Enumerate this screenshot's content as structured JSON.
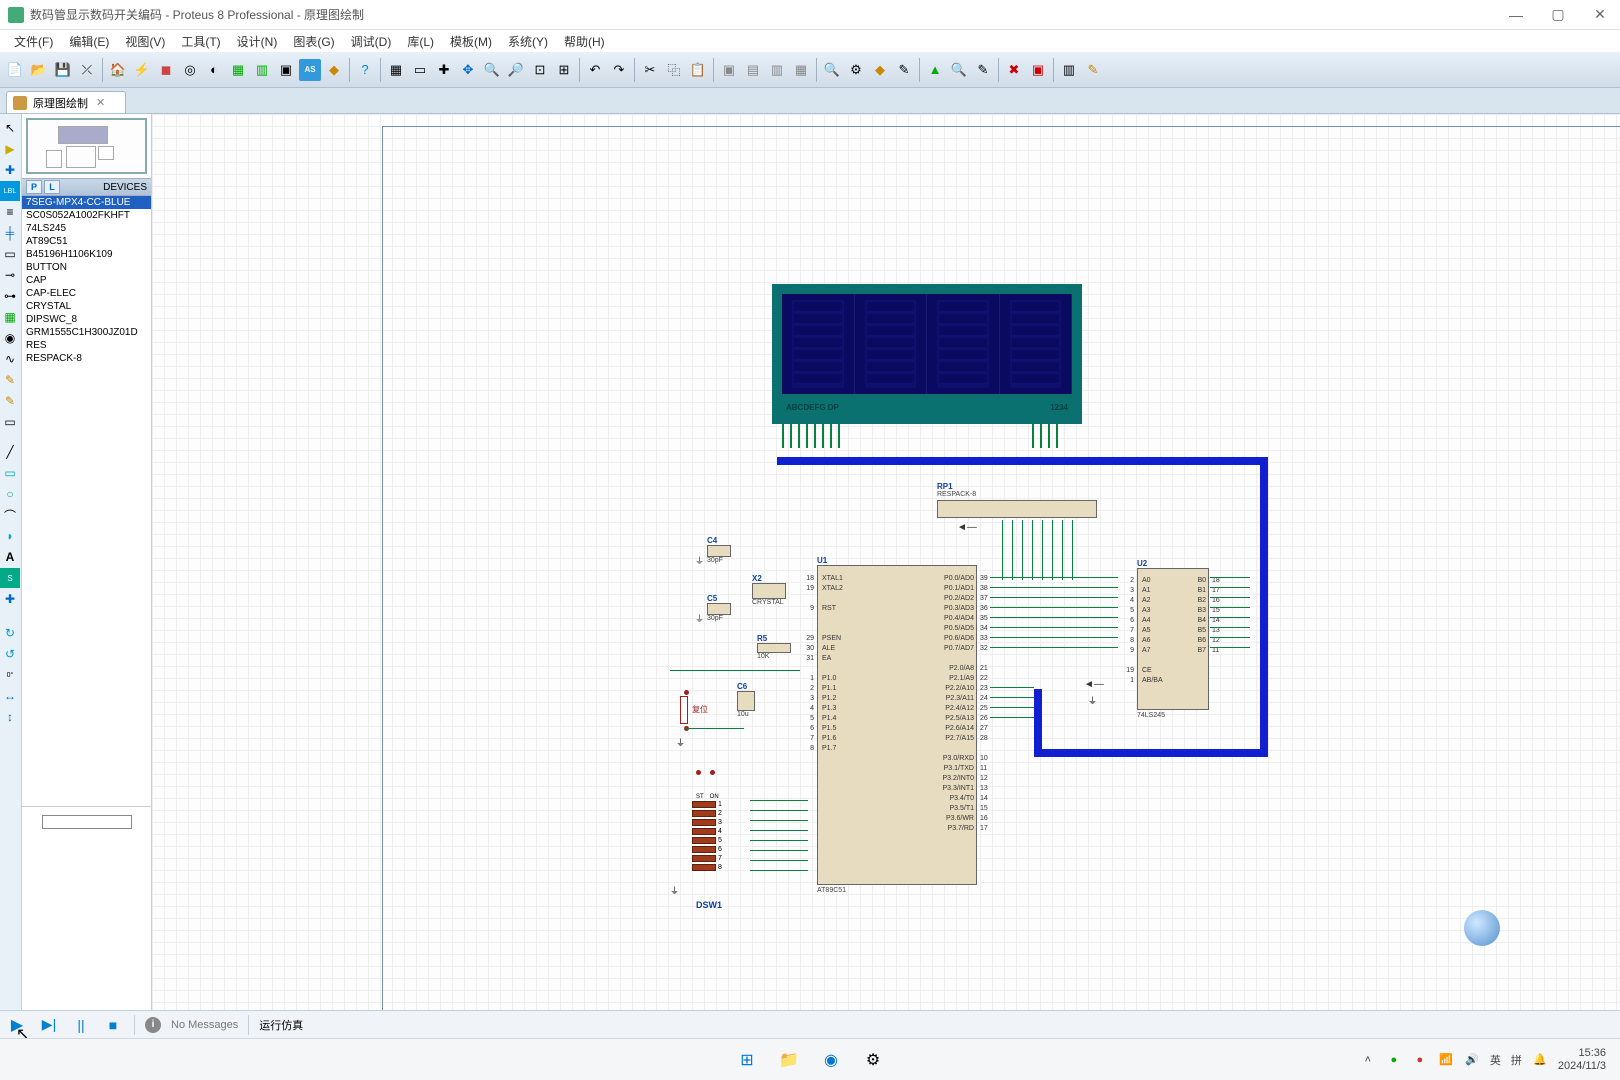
{
  "title": "数码管显示数码开关编码 - Proteus 8 Professional - 原理图绘制",
  "menu": [
    "文件(F)",
    "编辑(E)",
    "视图(V)",
    "工具(T)",
    "设计(N)",
    "图表(G)",
    "调试(D)",
    "库(L)",
    "模板(M)",
    "系统(Y)",
    "帮助(H)"
  ],
  "tab": {
    "label": "原理图绘制"
  },
  "panel": {
    "p": "P",
    "l": "L",
    "header": "DEVICES"
  },
  "devices": [
    "7SEG-MPX4-CC-BLUE",
    "SC0S052A1002FKHFT",
    "74LS245",
    "AT89C51",
    "B45196H1106K109",
    "BUTTON",
    "CAP",
    "CAP-ELEC",
    "CRYSTAL",
    "DIPSWC_8",
    "GRM1555C1H300JZ01D",
    "RES",
    "RESPACK-8"
  ],
  "display": {
    "left_label": "ABCDEFG DP",
    "right_label": "1234"
  },
  "rp1": {
    "name": "RP1",
    "val": "RESPACK-8"
  },
  "u1": {
    "name": "U1",
    "val": "AT89C51",
    "left_pins": [
      "XTAL1",
      "XTAL2",
      "",
      "RST",
      "",
      "",
      "PSEN",
      "ALE",
      "EA",
      "",
      "P1.0",
      "P1.1",
      "P1.2",
      "P1.3",
      "P1.4",
      "P1.5",
      "P1.6",
      "P1.7"
    ],
    "left_nums": [
      "18",
      "19",
      "",
      "9",
      "",
      "",
      "29",
      "30",
      "31",
      "",
      "1",
      "2",
      "3",
      "4",
      "5",
      "6",
      "7",
      "8"
    ],
    "right_pins": [
      "P0.0/AD0",
      "P0.1/AD1",
      "P0.2/AD2",
      "P0.3/AD3",
      "P0.4/AD4",
      "P0.5/AD5",
      "P0.6/AD6",
      "P0.7/AD7",
      "",
      "P2.0/A8",
      "P2.1/A9",
      "P2.2/A10",
      "P2.3/A11",
      "P2.4/A12",
      "P2.5/A13",
      "P2.6/A14",
      "P2.7/A15",
      "",
      "P3.0/RXD",
      "P3.1/TXD",
      "P3.2/INT0",
      "P3.3/INT1",
      "P3.4/T0",
      "P3.5/T1",
      "P3.6/WR",
      "P3.7/RD"
    ],
    "right_nums": [
      "39",
      "38",
      "37",
      "36",
      "35",
      "34",
      "33",
      "32",
      "",
      "21",
      "22",
      "23",
      "24",
      "25",
      "26",
      "27",
      "28",
      "",
      "10",
      "11",
      "12",
      "13",
      "14",
      "15",
      "16",
      "17"
    ]
  },
  "u2": {
    "name": "U2",
    "val": "74LS245",
    "left": [
      "A0",
      "A1",
      "A2",
      "A3",
      "A4",
      "A5",
      "A6",
      "A7",
      "",
      "CE",
      "AB/BA"
    ],
    "left_n": [
      "2",
      "3",
      "4",
      "5",
      "6",
      "7",
      "8",
      "9",
      "",
      "19",
      "1"
    ],
    "right": [
      "B0",
      "B1",
      "B2",
      "B3",
      "B4",
      "B5",
      "B6",
      "B7"
    ],
    "right_n": [
      "18",
      "17",
      "16",
      "15",
      "14",
      "13",
      "12",
      "11"
    ]
  },
  "caps": {
    "c4": "C4",
    "c4v": "30pF",
    "c5": "C5",
    "c5v": "30pF",
    "c6": "C6",
    "c6v": "10u",
    "x2": "X2",
    "x2v": "CRYSTAL",
    "r5": "R5",
    "r5v": "10K"
  },
  "dsw": {
    "name": "DSW1",
    "hdr_a": "ST",
    "hdr_b": "ON",
    "nums": [
      "1",
      "2",
      "3",
      "4",
      "5",
      "6",
      "7",
      "8"
    ]
  },
  "reset_btn": "复位",
  "sim": {
    "nomsg": "No Messages",
    "status": "运行仿真"
  },
  "tray": {
    "ime": "英",
    "pin": "拼",
    "time": "15:36",
    "date": "2024/11/3"
  }
}
